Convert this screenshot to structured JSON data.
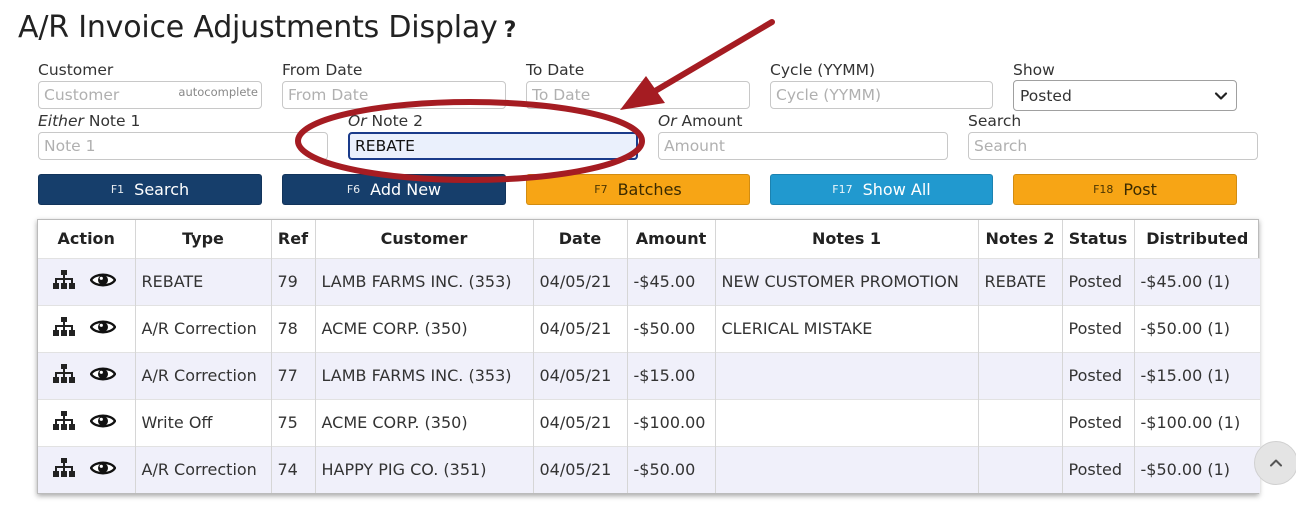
{
  "page": {
    "title": "A/R Invoice Adjustments Display",
    "help": "?"
  },
  "filters": {
    "customer": {
      "label": "Customer",
      "placeholder": "Customer",
      "hint": "autocomplete",
      "value": ""
    },
    "from_date": {
      "label": "From Date",
      "placeholder": "From Date",
      "value": ""
    },
    "to_date": {
      "label": "To Date",
      "placeholder": "To Date",
      "value": ""
    },
    "cycle": {
      "label": "Cycle (YYMM)",
      "placeholder": "Cycle (YYMM)",
      "value": ""
    },
    "show": {
      "label": "Show",
      "selected": "Posted"
    },
    "note1": {
      "label_prefix": "Either",
      "label": "Note 1",
      "placeholder": "Note 1",
      "value": ""
    },
    "note2": {
      "label_prefix": "Or",
      "label": "Note 2",
      "placeholder": "",
      "value": "REBATE"
    },
    "amount": {
      "label_prefix": "Or",
      "label": "Amount",
      "placeholder": "Amount",
      "value": ""
    },
    "search": {
      "label": "Search",
      "placeholder": "Search",
      "value": ""
    }
  },
  "buttons": {
    "search": {
      "key": "F1",
      "label": "Search"
    },
    "add_new": {
      "key": "F6",
      "label": "Add New"
    },
    "batches": {
      "key": "F7",
      "label": "Batches"
    },
    "show_all": {
      "key": "F17",
      "label": "Show All"
    },
    "post": {
      "key": "F18",
      "label": "Post"
    }
  },
  "table": {
    "headers": [
      "Action",
      "Type",
      "Ref",
      "Customer",
      "Date",
      "Amount",
      "Notes 1",
      "Notes 2",
      "Status",
      "Distributed"
    ],
    "rows": [
      {
        "type": "REBATE",
        "ref": "79",
        "customer": "LAMB FARMS INC. (353)",
        "date": "04/05/21",
        "amount": "-$45.00",
        "notes1": "NEW CUSTOMER PROMOTION",
        "notes2": "REBATE",
        "status": "Posted",
        "distributed": "-$45.00 (1)"
      },
      {
        "type": "A/R Correction",
        "ref": "78",
        "customer": "ACME CORP. (350)",
        "date": "04/05/21",
        "amount": "-$50.00",
        "notes1": "CLERICAL MISTAKE",
        "notes2": "",
        "status": "Posted",
        "distributed": "-$50.00 (1)"
      },
      {
        "type": "A/R Correction",
        "ref": "77",
        "customer": "LAMB FARMS INC. (353)",
        "date": "04/05/21",
        "amount": "-$15.00",
        "notes1": "",
        "notes2": "",
        "status": "Posted",
        "distributed": "-$15.00 (1)"
      },
      {
        "type": "Write Off",
        "ref": "75",
        "customer": "ACME CORP. (350)",
        "date": "04/05/21",
        "amount": "-$100.00",
        "notes1": "",
        "notes2": "",
        "status": "Posted",
        "distributed": "-$100.00 (1)"
      },
      {
        "type": "A/R Correction",
        "ref": "74",
        "customer": "HAPPY PIG CO. (351)",
        "date": "04/05/21",
        "amount": "-$50.00",
        "notes1": "",
        "notes2": "",
        "status": "Posted",
        "distributed": "-$50.00 (1)"
      }
    ],
    "row_icons": [
      "hierarchy-icon",
      "eye-icon"
    ]
  },
  "colors": {
    "button_dark": "#163e6b",
    "button_orange": "#f7a515",
    "button_teal": "#2199cf",
    "row_alt": "#f0f0fa",
    "annotation_red": "#a51c22"
  }
}
